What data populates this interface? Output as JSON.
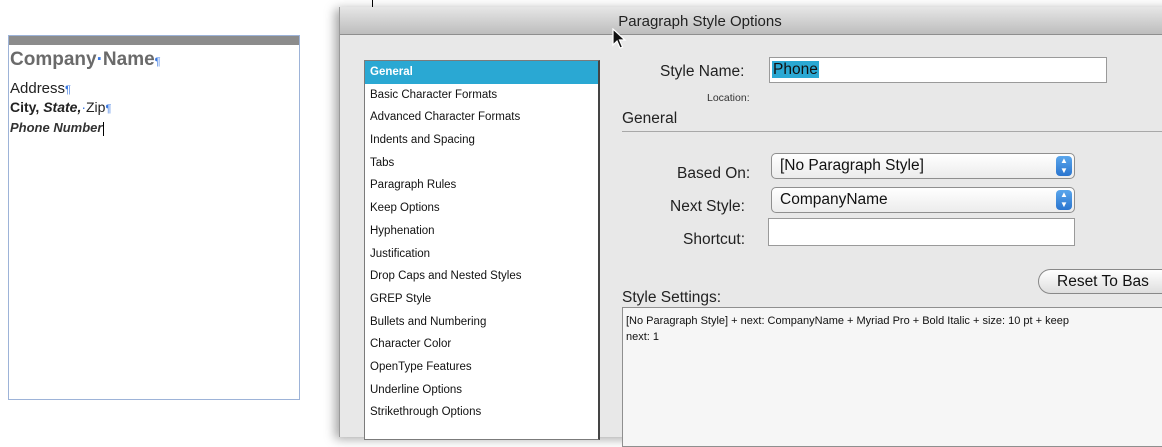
{
  "document": {
    "company": "Company",
    "company_dot": "·",
    "company_name": "Name",
    "pilcrow": "¶",
    "address": "Address",
    "city": "City,",
    "state": "State,",
    "state_dot": "·",
    "zip": "Zip",
    "phone": "Phone Number"
  },
  "dialog": {
    "title": "Paragraph Style Options",
    "categories": [
      "General",
      "Basic Character Formats",
      "Advanced Character Formats",
      "Indents and Spacing",
      "Tabs",
      "Paragraph Rules",
      "Keep Options",
      "Hyphenation",
      "Justification",
      "Drop Caps and Nested Styles",
      "GREP Style",
      "Bullets and Numbering",
      "Character Color",
      "OpenType Features",
      "Underline Options",
      "Strikethrough Options"
    ],
    "selected_category": "General",
    "style_name_label": "Style Name:",
    "style_name_value": "Phone",
    "location_label": "Location:",
    "section_title": "General",
    "based_on_label": "Based On:",
    "based_on_value": "[No Paragraph Style]",
    "next_style_label": "Next Style:",
    "next_style_value": "CompanyName",
    "shortcut_label": "Shortcut:",
    "shortcut_value": "",
    "reset_button_label": "Reset To Bas",
    "style_settings_label": "Style Settings:",
    "style_settings_line1": "[No Paragraph Style] + next: CompanyName + Myriad Pro + Bold Italic + size: 10 pt + keep",
    "style_settings_line2": "next:  1"
  },
  "icons": {
    "popup_arrows": "up-down-arrows-icon",
    "pointer": "mouse-pointer-icon"
  },
  "colors": {
    "selection": "#2aa8d3",
    "pilcrow": "#3b78e0",
    "frame_border": "#9db3d8"
  }
}
